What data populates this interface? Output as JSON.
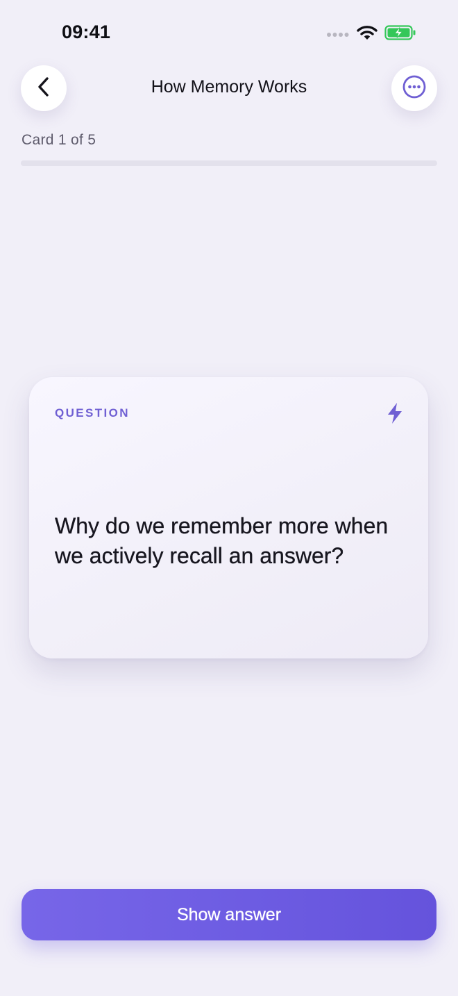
{
  "status_bar": {
    "time": "09:41",
    "icons": [
      "signal-dots-icon",
      "wifi-icon",
      "battery-charging-icon"
    ],
    "battery_color": "#34c759"
  },
  "header": {
    "title": "How Memory Works",
    "back_icon": "chevron-left-icon",
    "more_icon": "more-horizontal-icon"
  },
  "progress": {
    "label": "Card 1 of 5",
    "current": 1,
    "total": 5
  },
  "card": {
    "label": "QUESTION",
    "icon": "lightning-bolt-icon",
    "question": "Why do we remember more when we actively recall an answer?"
  },
  "actions": {
    "primary_label": "Show answer"
  },
  "colors": {
    "accent": "#6f5fd3",
    "button": "#6d5ce2",
    "background": "#f1eff8"
  }
}
